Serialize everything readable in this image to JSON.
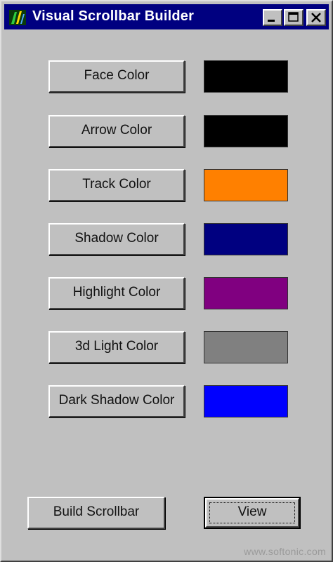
{
  "window": {
    "title": "Visual Scrollbar Builder",
    "icon": "app-icon",
    "controls": {
      "minimize": "minimize-icon",
      "maximize": "maximize-icon",
      "close": "close-icon"
    }
  },
  "colors": [
    {
      "label": "Face Color",
      "swatch": "#000000"
    },
    {
      "label": "Arrow Color",
      "swatch": "#000000"
    },
    {
      "label": "Track Color",
      "swatch": "#ff8000"
    },
    {
      "label": "Shadow Color",
      "swatch": "#000080"
    },
    {
      "label": "Highlight Color",
      "swatch": "#800080"
    },
    {
      "label": "3d Light Color",
      "swatch": "#808080"
    },
    {
      "label": "Dark Shadow Color",
      "swatch": "#0000ff"
    }
  ],
  "actions": {
    "build_label": "Build Scrollbar",
    "view_label": "View"
  },
  "watermark": "www.softonic.com",
  "theme": {
    "titlebar": "#000080",
    "face": "#c0c0c0"
  }
}
